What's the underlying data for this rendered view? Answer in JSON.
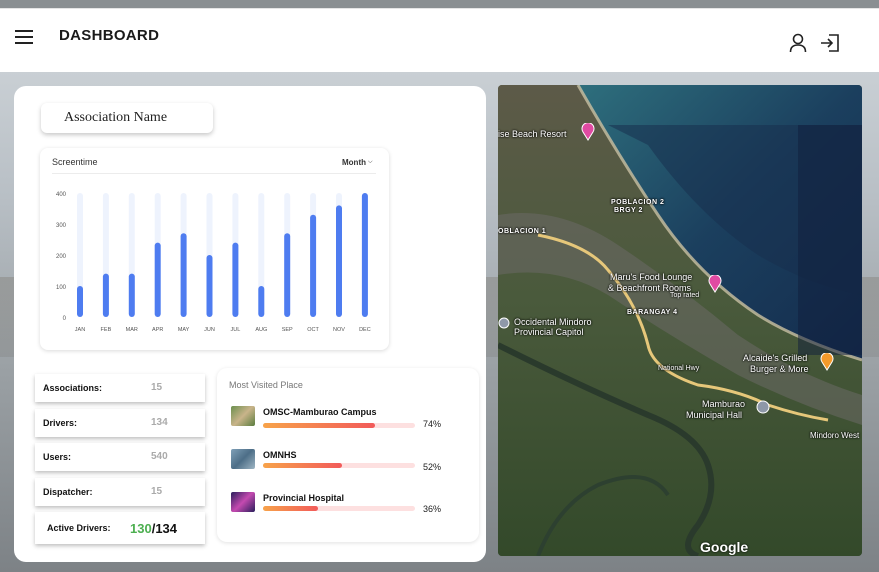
{
  "header": {
    "title": "DASHBOARD"
  },
  "association": {
    "name": "Association Name"
  },
  "screentime": {
    "title": "Screentime",
    "period": "Month",
    "y_ticks": [
      "400",
      "300",
      "200",
      "100",
      "0"
    ]
  },
  "chart_data": {
    "type": "bar",
    "title": "Screentime",
    "categories": [
      "JAN",
      "FEB",
      "MAR",
      "APR",
      "MAY",
      "JUN",
      "JUL",
      "AUG",
      "SEP",
      "OCT",
      "NOV",
      "DEC"
    ],
    "values": [
      100,
      140,
      140,
      240,
      270,
      200,
      240,
      100,
      270,
      330,
      360,
      400
    ],
    "ylim": [
      0,
      400
    ],
    "grid": false,
    "color": "#4e7cf0"
  },
  "stats": [
    {
      "label": "Associations:",
      "value": "15"
    },
    {
      "label": "Drivers:",
      "value": "134"
    },
    {
      "label": "Users:",
      "value": "540"
    },
    {
      "label": "Dispatcher:",
      "value": "15"
    }
  ],
  "active_drivers": {
    "label": "Active Drivers:",
    "active": "130",
    "total": "/134"
  },
  "most_visited": {
    "title": "Most Visited Place",
    "places": [
      {
        "name": "OMSC-Mamburao Campus",
        "percent": 74,
        "percent_label": "74%"
      },
      {
        "name": "OMNHS",
        "percent": 52,
        "percent_label": "52%"
      },
      {
        "name": "Provincial Hospital",
        "percent": 36,
        "percent_label": "36%"
      }
    ]
  },
  "map": {
    "labels": {
      "resort": "ise Beach Resort",
      "poblacion2": "POBLACION 2",
      "brgy2": "BRGY 2",
      "poblacion1": "OBLACION 1",
      "food1": "Maru's Food Lounge",
      "food2": "& Beachfront Rooms",
      "toprated": "Top rated",
      "barangay4": "BARANGAY 4",
      "capitol1": "Occidental Mindoro",
      "capitol2": "Provincial Capitol",
      "nationalhwy": "National Hwy",
      "grill1": "Alcaide's Grilled",
      "grill2": "Burger & More",
      "hall1": "Mamburao",
      "hall2": "Municipal Hall",
      "street": "Mindoro West"
    },
    "attribution": "Google"
  },
  "colors": {
    "accent": "#4e7cf0",
    "active": "#4caf50",
    "bar_gradient_start": "#f7a34a",
    "bar_gradient_end": "#f25a5a"
  }
}
